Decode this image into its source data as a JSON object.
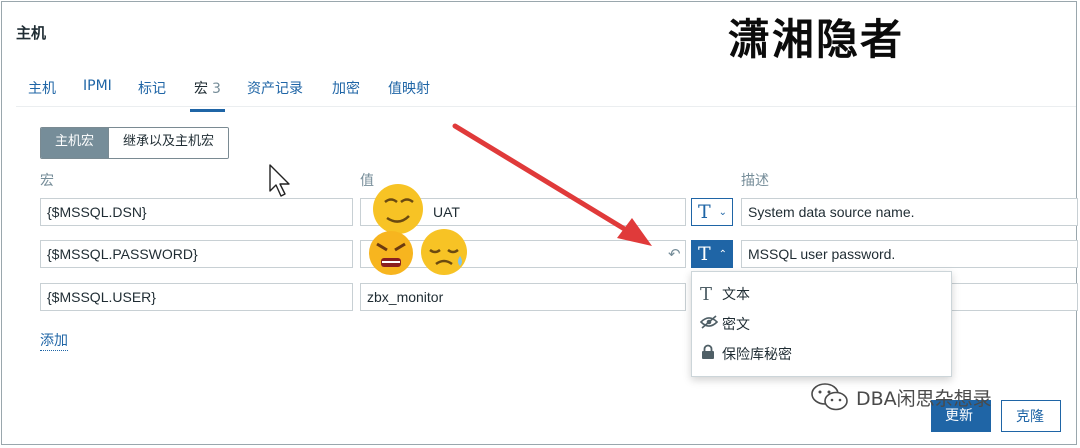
{
  "dialog": {
    "title": "主机"
  },
  "watermark": {
    "top": "潇湘隐者",
    "bottom": "DBA闲思杂想录"
  },
  "tabs": [
    {
      "label": "主机"
    },
    {
      "label": "IPMI"
    },
    {
      "label": "标记"
    },
    {
      "label": "宏",
      "count": "3",
      "active": true
    },
    {
      "label": "资产记录"
    },
    {
      "label": "加密"
    },
    {
      "label": "值映射"
    }
  ],
  "macro_toggle": {
    "host_label": "主机宏",
    "inherited_label": "继承以及主机宏"
  },
  "columns": {
    "macro": "宏",
    "value": "值",
    "description": "描述"
  },
  "rows": [
    {
      "macro": "{$MSSQL.DSN}",
      "value": "UAT",
      "description": "System data source name."
    },
    {
      "macro": "{$MSSQL.PASSWORD}",
      "value": "",
      "description": "MSSQL user password."
    },
    {
      "macro": "{$MSSQL.USER}",
      "value": "zbx_monitor",
      "description": ""
    }
  ],
  "type_menu": {
    "text": "文本",
    "secret": "密文",
    "vault": "保险库秘密"
  },
  "add_label": "添加",
  "buttons": {
    "update": "更新",
    "clone": "克隆"
  },
  "colors": {
    "accent": "#1f65a6",
    "arrow": "#e03a3a"
  },
  "icons": [
    "text-type-icon",
    "chevron-down-icon",
    "chevron-up-icon",
    "revert-icon",
    "eye-off-icon",
    "lock-icon",
    "cursor-icon"
  ]
}
